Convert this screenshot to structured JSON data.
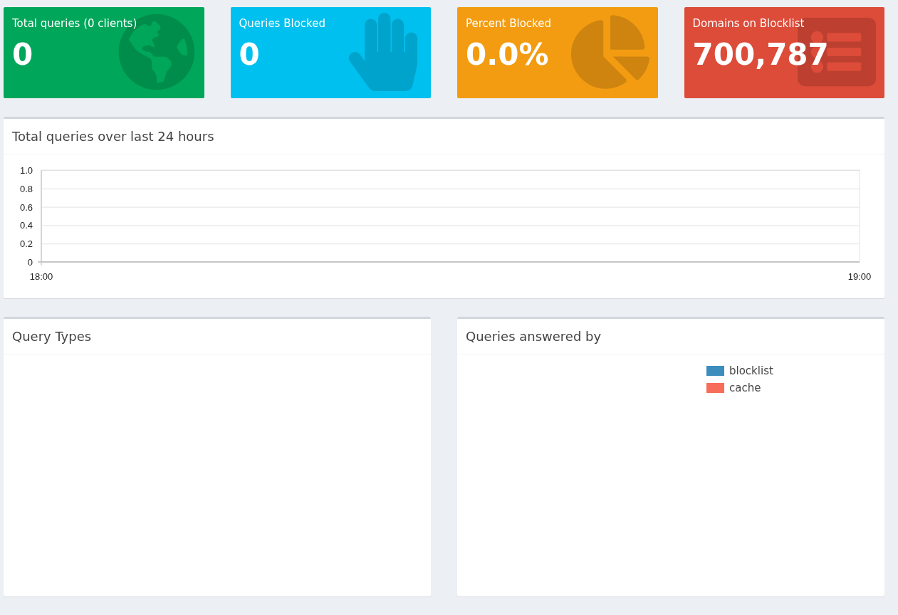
{
  "stats": [
    {
      "label": "Total queries (0 clients)",
      "value": "0",
      "color": "#00a65a",
      "kind": "globe"
    },
    {
      "label": "Queries Blocked",
      "value": "0",
      "color": "#00c0ef",
      "kind": "hand"
    },
    {
      "label": "Percent Blocked",
      "value": "0.0%",
      "color": "#f39c12",
      "kind": "pie"
    },
    {
      "label": "Domains on Blocklist",
      "value": "700,787",
      "color": "#dd4b39",
      "kind": "list"
    }
  ],
  "history": {
    "title": "Total queries over last 24 hours",
    "chart_data": {
      "type": "line",
      "categories": [
        "18:00",
        "19:00"
      ],
      "ylim": [
        0,
        1
      ],
      "yticks": [
        {
          "value": 0,
          "label": "0"
        },
        {
          "value": 0.2,
          "label": "0.2"
        },
        {
          "value": 0.4,
          "label": "0.4"
        },
        {
          "value": 0.6,
          "label": "0.6"
        },
        {
          "value": 0.8,
          "label": "0.8"
        },
        {
          "value": 1,
          "label": "1.0"
        }
      ]
    }
  },
  "query_types": {
    "title": "Query Types"
  },
  "answered_by": {
    "title": "Queries answered by",
    "legend": [
      {
        "label": "blocklist",
        "color": "#3c8dbc"
      },
      {
        "label": "cache",
        "color": "#f86c5a"
      }
    ]
  }
}
